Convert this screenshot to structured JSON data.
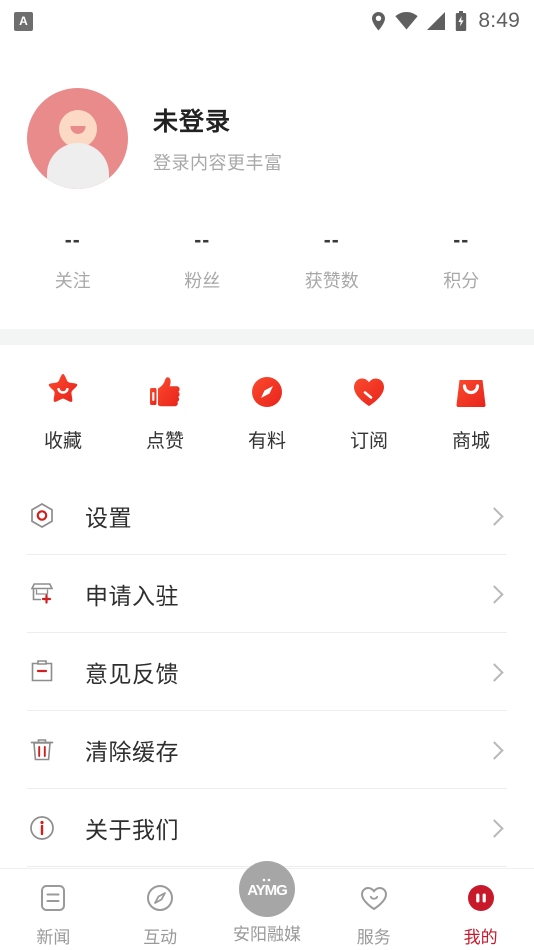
{
  "status_bar": {
    "app_badge": "A",
    "time": "8:49",
    "icons": [
      "location-pin-icon",
      "wifi-icon",
      "cellular-signal-icon",
      "battery-icon"
    ]
  },
  "profile": {
    "avatar": "default-user-avatar",
    "title": "未登录",
    "subtitle": "登录内容更丰富"
  },
  "stats": [
    {
      "value": "--",
      "label": "关注"
    },
    {
      "value": "--",
      "label": "粉丝"
    },
    {
      "value": "--",
      "label": "获赞数"
    },
    {
      "value": "--",
      "label": "积分"
    }
  ],
  "quick_actions": [
    {
      "icon": "star-icon",
      "label": "收藏"
    },
    {
      "icon": "thumbs-up-icon",
      "label": "点赞"
    },
    {
      "icon": "compass-icon",
      "label": "有料"
    },
    {
      "icon": "heart-icon",
      "label": "订阅"
    },
    {
      "icon": "shopping-bag-icon",
      "label": "商城"
    }
  ],
  "menu": [
    {
      "icon": "settings-hexagon-icon",
      "label": "设置"
    },
    {
      "icon": "shop-apply-icon",
      "label": "申请入驻"
    },
    {
      "icon": "feedback-clipboard-icon",
      "label": "意见反馈"
    },
    {
      "icon": "trash-icon",
      "label": "清除缓存"
    },
    {
      "icon": "info-circle-icon",
      "label": "关于我们"
    }
  ],
  "tabbar": [
    {
      "icon": "news-document-icon",
      "label": "新闻",
      "active": false
    },
    {
      "icon": "compass-outline-icon",
      "label": "互动",
      "active": false
    },
    {
      "icon": "aymg-logo-icon",
      "label": "安阳融媒",
      "active": false
    },
    {
      "icon": "heart-outline-icon",
      "label": "服务",
      "active": false
    },
    {
      "icon": "profile-active-icon",
      "label": "我的",
      "active": true
    }
  ],
  "colors": {
    "accent_red": "#c8192b",
    "icon_red_gradient_start": "#fb3c2e",
    "icon_red_gradient_end": "#e8231b",
    "avatar_pink": "#e98b8b",
    "band_gray": "#f3f4f4",
    "muted_text": "#a8a8a8"
  }
}
